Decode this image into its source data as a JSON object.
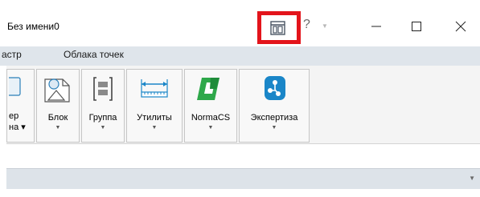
{
  "window": {
    "title": "Без имени0",
    "help_label": "?",
    "help_arrow": "▼"
  },
  "tabs": [
    "астр",
    "Облака точек"
  ],
  "ribbon": {
    "groups": [
      {
        "label_lines": [
          "ер",
          "на ▾"
        ],
        "icon": "partial-icon"
      },
      {
        "label": "Блок",
        "icon": "block-icon"
      },
      {
        "label": "Группа",
        "icon": "group-icon"
      },
      {
        "label": "Утилиты",
        "icon": "ruler-icon"
      },
      {
        "label": "NormaCS",
        "icon": "normacs-icon"
      },
      {
        "label": "Экспертиза",
        "icon": "expertiza-icon"
      }
    ],
    "group_arrow": "▼"
  },
  "panel_arrow": "▼",
  "colors": {
    "highlight": "#e3141b",
    "normacs": "#2ea84a",
    "expertiza": "#1a86c8"
  }
}
